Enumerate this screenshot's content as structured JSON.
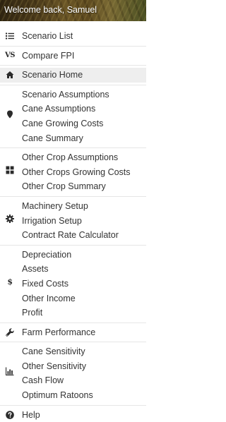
{
  "header": {
    "welcome_text": "Welcome back, Samuel"
  },
  "menu": {
    "sections": [
      {
        "icon": "list-icon",
        "items": [
          {
            "label": "Scenario List"
          }
        ]
      },
      {
        "icon": "vs-icon",
        "icon_text": "VS",
        "items": [
          {
            "label": "Compare FPI"
          }
        ]
      },
      {
        "icon": "home-icon",
        "items": [
          {
            "label": "Scenario Home",
            "active": true
          }
        ]
      },
      {
        "icon": "map-marker-icon",
        "items": [
          {
            "label": "Scenario Assumptions"
          },
          {
            "label": "Cane Assumptions"
          },
          {
            "label": "Cane Growing Costs"
          },
          {
            "label": "Cane Summary"
          }
        ]
      },
      {
        "icon": "grid-icon",
        "items": [
          {
            "label": "Other Crop Assumptions"
          },
          {
            "label": "Other Crops Growing Costs"
          },
          {
            "label": "Other Crop Summary"
          }
        ]
      },
      {
        "icon": "gear-icon",
        "items": [
          {
            "label": "Machinery Setup"
          },
          {
            "label": "Irrigation Setup"
          },
          {
            "label": "Contract Rate Calculator"
          }
        ]
      },
      {
        "icon": "dollar-icon",
        "icon_text": "$",
        "items": [
          {
            "label": "Depreciation"
          },
          {
            "label": "Assets"
          },
          {
            "label": "Fixed Costs"
          },
          {
            "label": "Other Income"
          },
          {
            "label": "Profit"
          }
        ]
      },
      {
        "icon": "wrench-icon",
        "items": [
          {
            "label": "Farm Performance"
          }
        ]
      },
      {
        "icon": "chart-icon",
        "items": [
          {
            "label": "Cane Sensitivity"
          },
          {
            "label": "Other Sensitivity"
          },
          {
            "label": "Cash Flow"
          },
          {
            "label": "Optimum Ratoons"
          }
        ]
      },
      {
        "icon": "help-icon",
        "items": [
          {
            "label": "Help"
          }
        ]
      }
    ]
  }
}
